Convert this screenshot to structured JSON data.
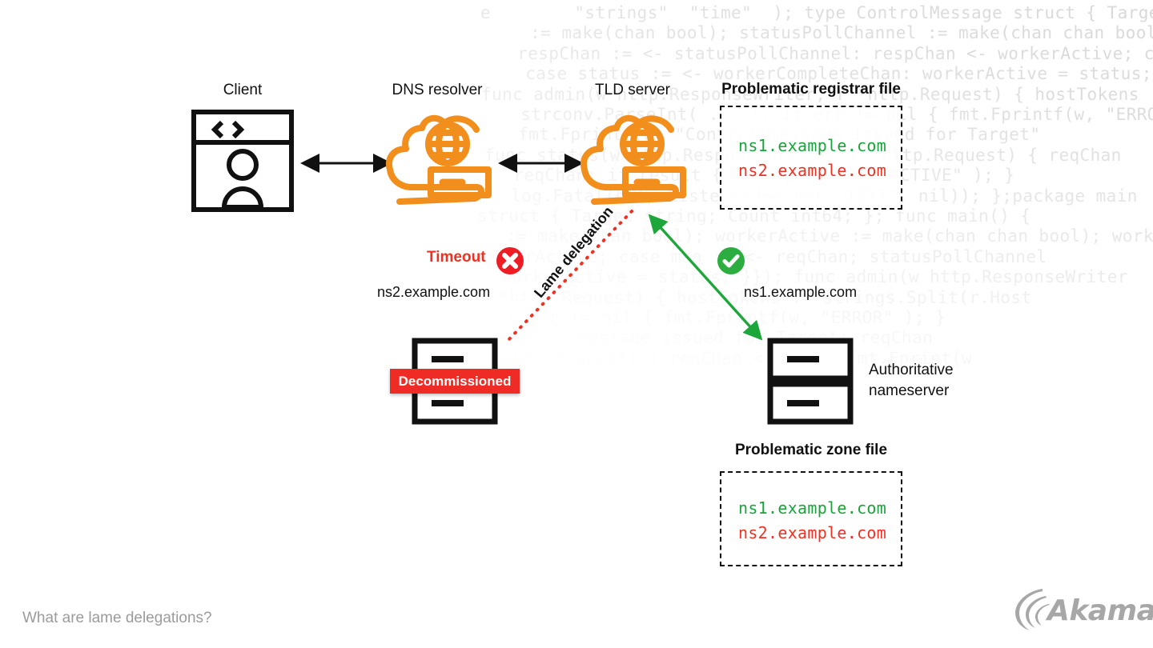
{
  "page": {
    "footer_caption": "What are lame delegations?",
    "brand": "Akamai"
  },
  "colors": {
    "orange": "#F28E1C",
    "black": "#111111",
    "red": "#EF3124",
    "green": "#1DA639",
    "grey": "#9B9B9B",
    "code_grey": "#D8D8D8"
  },
  "nodes": {
    "client": {
      "label": "Client",
      "icon": "browser-user-icon"
    },
    "dns_resolver": {
      "label": "DNS resolver",
      "icon": "cloud-server-globe-icon"
    },
    "tld_server": {
      "label": "TLD server",
      "icon": "cloud-server-globe-icon"
    },
    "decommissioned_server": {
      "label": "Decommissioned",
      "icon": "server-rack-icon"
    },
    "authoritative_nameserver": {
      "label_line1": "Authoritative",
      "label_line2": "nameserver",
      "icon": "server-rack-icon"
    }
  },
  "files": {
    "registrar": {
      "title": "Problematic registrar file",
      "entries": [
        {
          "text": "ns1.example.com",
          "state": "ok"
        },
        {
          "text": "ns2.example.com",
          "state": "bad"
        }
      ]
    },
    "zone": {
      "title": "Problematic zone file",
      "entries": [
        {
          "text": "ns1.example.com",
          "state": "ok"
        },
        {
          "text": "ns2.example.com",
          "state": "bad"
        }
      ]
    }
  },
  "annotations": {
    "timeout": {
      "label": "Timeout",
      "icon": "error-cross-icon"
    },
    "timeout_ns": "ns2.example.com",
    "lame_delegation": "Lame delegation",
    "success": {
      "icon": "success-check-icon"
    },
    "success_ns": "ns1.example.com"
  },
  "connections": [
    {
      "name": "client-to-resolver",
      "style": "solid-black",
      "arrows": "both"
    },
    {
      "name": "resolver-to-tld",
      "style": "solid-black",
      "arrows": "both"
    },
    {
      "name": "tld-to-decommissioned",
      "style": "dotted-red",
      "arrows": "none"
    },
    {
      "name": "tld-to-authoritative",
      "style": "solid-green",
      "arrows": "both"
    }
  ],
  "background_code": {
    "language": "go",
    "lines": [
      "e        \"strings\"  \"time\"  ); type ControlMessage struct { Target string; Count",
      "     := make(chan bool); statusPollChannel := make(chan chan bool); workerActive",
      "    respChan := <- statusPollChannel: respChan <- workerActive; case status :=",
      "     case status := <- workerCompleteChan: workerActive = status;",
      " func admin(w http.ResponseWriter, r *http.Request) { hostTokens :=",
      "     strconv.ParseInt( ... ); if err != nil { fmt.Fprintf(w, \"ERROR\"",
      "     fmt.Fprintf(w, \"Control message issued for Target\"",
      "  func status(w http.ResponseWriter, r *http.Request) { reqChan",
      "     reqChan; if result { fmt.Fprint(w, \"ACTIVE\" ); }",
      "     log.Fatal(http.ListenAndServe(\":1337\", nil)); };package main",
      "  struct { Target string; Count int64; }; func main() {",
      "     := make(chan bool); workerActive := make(chan chan bool); workerActive",
      "  workerActive; case msg := <- reqChan; statusPollChannel",
      "     workerActive = status; }}); func admin(w http.ResponseWriter",
      "   r *http.Request) { hostTokens := strings.Split(r.Host",
      "     if err != nil { fmt.Fprintf(w, \"ERROR\" ); }",
      "     Control message issued for Target; reqChan",
      "   r *http.Request) { reqChan <- true; fmt.Fprint(w"
    ]
  }
}
